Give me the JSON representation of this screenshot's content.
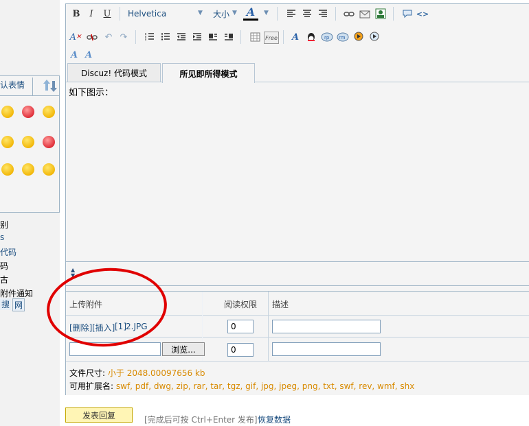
{
  "toolbar": {
    "bold": "B",
    "italic": "I",
    "underline": "U",
    "font_family": "Helvetica",
    "font_size": "大小",
    "font_color_letter": "A",
    "paste_free": "Free"
  },
  "tabs": [
    {
      "label": "Discuz! 代码模式",
      "active": false
    },
    {
      "label": "所见即所得模式",
      "active": true
    }
  ],
  "editor": {
    "content": "如下图示："
  },
  "smileys": {
    "tab_label": "认表情",
    "icons": [
      "smiley-icon",
      "smiley-red-icon",
      "smiley-icon",
      "smiley-icon",
      "smiley-icon",
      "smiley-red-icon",
      "smiley-icon",
      "smiley-icon",
      "smiley-glasses-icon"
    ]
  },
  "side_menu": [
    {
      "text": "别",
      "link": false
    },
    {
      "text": "s",
      "link": true
    },
    {
      "text": "代码",
      "link": true
    },
    {
      "text": "码",
      "link": false
    },
    {
      "text": "古",
      "link": false
    },
    {
      "text": "附件通知",
      "link": false
    },
    {
      "text": "搜",
      "link": true
    },
    {
      "text": "网",
      "link": true
    }
  ],
  "attachments": {
    "headers": {
      "upload": "上传附件",
      "read_perm": "阅读权限",
      "desc": "描述"
    },
    "row1": {
      "delete": "[删除]",
      "insert": "[插入]",
      "index": "[1]",
      "filename": "2.JPG",
      "perm": "0",
      "desc": ""
    },
    "row2": {
      "browse": "浏览...",
      "perm": "0",
      "desc": ""
    },
    "size_label": "文件尺寸:",
    "size_value": "小于 2048.00097656 kb",
    "ext_label": "可用扩展名:",
    "ext_value": "swf, pdf, dwg, zip, rar, tar, tgz, gif, jpg, jpeg, png, txt, swf, rev, wmf, shx"
  },
  "footer": {
    "submit": "发表回复",
    "hint": "[完成后可按 Ctrl+Enter 发布]",
    "restore": "恢复数据"
  },
  "colors": {
    "highlight_ellipse": "#e00000",
    "accent_link": "#1d4f80",
    "orange_text": "#d88a00"
  }
}
